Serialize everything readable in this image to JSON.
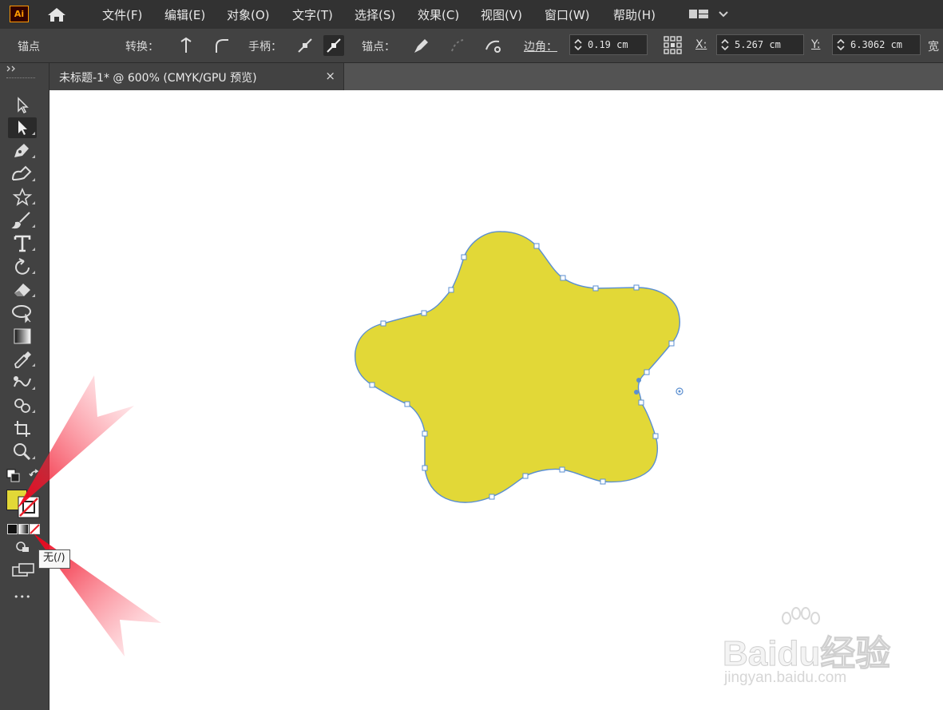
{
  "app": {
    "logo": "Ai"
  },
  "menu": {
    "items": [
      "文件(F)",
      "编辑(E)",
      "对象(O)",
      "文字(T)",
      "选择(S)",
      "效果(C)",
      "视图(V)",
      "窗口(W)",
      "帮助(H)"
    ]
  },
  "control": {
    "anchor_label": "锚点",
    "convert_label": "转换：",
    "handles_label": "手柄：",
    "anchors_label": "锚点：",
    "corner_label": "边角：",
    "corner_value": "0.19 cm",
    "x_label": "X:",
    "x_value": "5.267 cm",
    "y_label": "Y:",
    "y_value": "6.3062 cm",
    "width_label": "宽"
  },
  "document": {
    "tab_title": "未标题-1* @ 600% (CMYK/GPU 预览)",
    "close_glyph": "×"
  },
  "toolbar": {
    "tools": [
      "selection-tool",
      "direct-selection-tool",
      "pen-tool",
      "curvature-tool",
      "star-tool",
      "paintbrush-tool",
      "type-tool",
      "rotate-tool",
      "eraser-tool",
      "lasso-tool",
      "gradient-tool",
      "eyedropper-tool",
      "blend-tool",
      "shape-builder-tool",
      "artboard-tool",
      "zoom-tool"
    ],
    "active_tool": "direct-selection-tool",
    "fill_color": "#e2d837",
    "stroke": "none",
    "more_glyph": "•••"
  },
  "tooltip": {
    "text": "无(/)"
  },
  "artwork": {
    "shape": "rounded-star",
    "fill": "#e2d837",
    "outline": "#5b8fd0"
  },
  "watermark": {
    "brand": "Baidu经验",
    "url": "jingyan.baidu.com"
  }
}
